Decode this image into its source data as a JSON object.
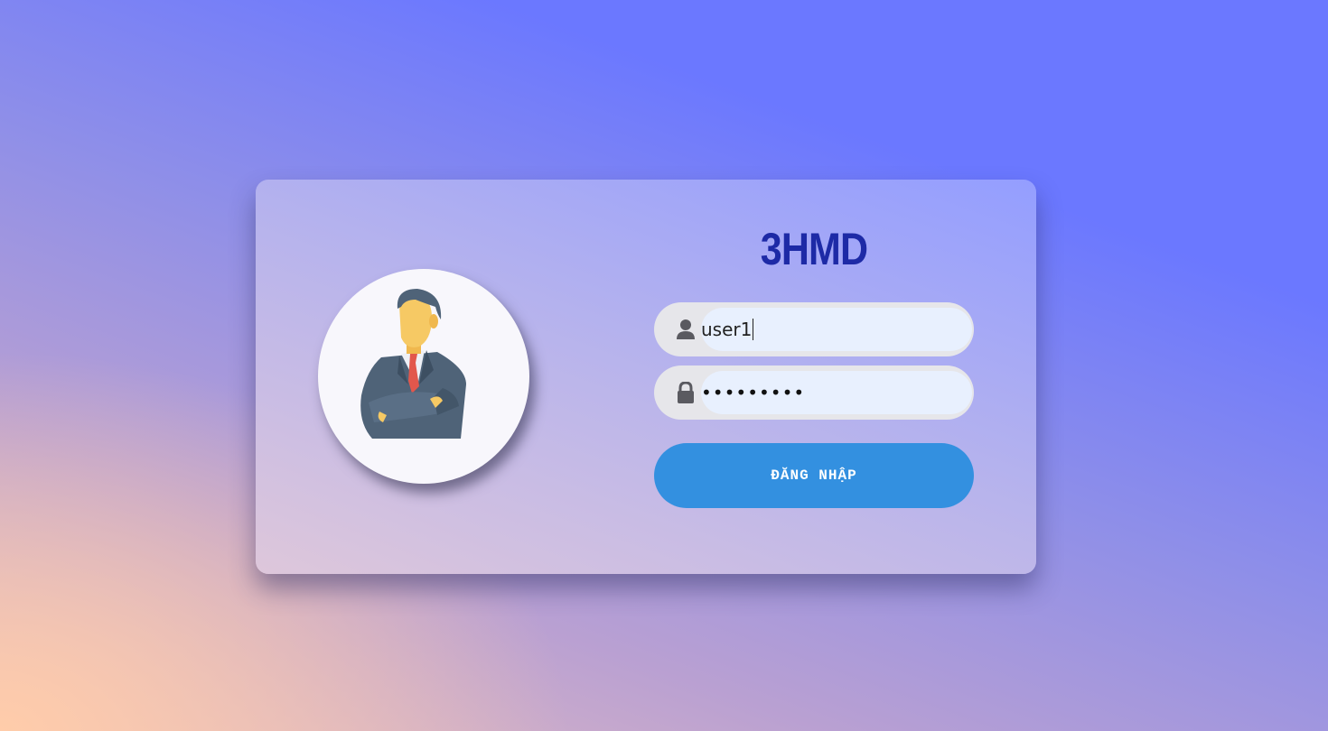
{
  "login": {
    "brand": "3HMD",
    "username_value": "user1",
    "password_masked": "•••••••••",
    "submit_label": "ĐĂNG NHẬP"
  },
  "icons": {
    "avatar": "businessman-avatar-icon",
    "username": "user-icon",
    "password": "lock-icon"
  },
  "colors": {
    "brand_text": "#1d2aa6",
    "button": "#3390e0",
    "input_bg": "#e8f0fe"
  }
}
